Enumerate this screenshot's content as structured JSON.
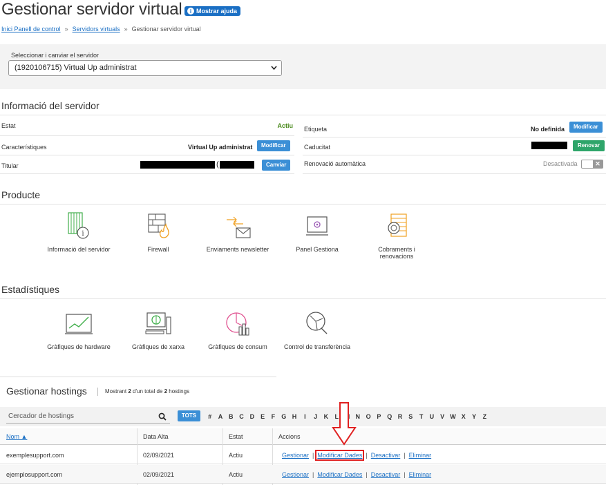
{
  "page": {
    "title": "Gestionar servidor virtual",
    "help_label": "Mostrar ajuda",
    "breadcrumb": [
      "Inici Panell de control",
      "Servidors virtuals",
      "Gestionar servidor virtual"
    ]
  },
  "server_selector": {
    "label": "Seleccionar i canviar el servidor",
    "selected": "(1920106715) Virtual Up administrat"
  },
  "server_info": {
    "heading": "Informació del servidor",
    "estat_label": "Estat",
    "estat_value": "Actiu",
    "caracteristiques_label": "Característiques",
    "caracteristiques_value": "Virtual Up administrat",
    "modify_label": "Modificar",
    "titular_label": "Titular",
    "titular_paren": "(",
    "canviar_label": "Canviar",
    "etiqueta_label": "Etiqueta",
    "etiqueta_value": "No definida",
    "modify_label_2": "Modificar",
    "caducitat_label": "Caducitat",
    "renovar_label": "Renovar",
    "renovacio_label": "Renovació automàtica",
    "renovacio_value": "Desactivada",
    "status_color": "#4a8a1c"
  },
  "producte": {
    "heading": "Producte",
    "tiles": [
      {
        "label": "Informació del servidor",
        "icon": "server-info-icon"
      },
      {
        "label": "Firewall",
        "icon": "firewall-icon"
      },
      {
        "label": "Enviaments newsletter",
        "icon": "newsletter-icon"
      },
      {
        "label": "Panel Gestiona",
        "icon": "panel-icon"
      },
      {
        "label": "Cobraments i renovacions",
        "icon": "billing-icon"
      }
    ]
  },
  "estadistiques": {
    "heading": "Estadístiques",
    "tiles": [
      {
        "label": "Gràfiques de hardware",
        "icon": "hardware-chart-icon"
      },
      {
        "label": "Gràfiques de xarxa",
        "icon": "network-chart-icon"
      },
      {
        "label": "Gràfiques de consum",
        "icon": "consumption-chart-icon"
      },
      {
        "label": "Control de transferència",
        "icon": "transfer-control-icon"
      }
    ]
  },
  "hostings": {
    "heading": "Gestionar hostings",
    "count_prefix": "Mostrant ",
    "count_shown": "2",
    "count_mid": " d'un total de ",
    "count_total": "2",
    "count_suffix": " hostings",
    "search_placeholder": "Cercador de hostings",
    "all_label": "TOTS",
    "letters": [
      "#",
      "A",
      "B",
      "C",
      "D",
      "E",
      "F",
      "G",
      "H",
      "I",
      "J",
      "K",
      "L",
      "M",
      "N",
      "O",
      "P",
      "Q",
      "R",
      "S",
      "T",
      "U",
      "V",
      "W",
      "X",
      "Y",
      "Z"
    ],
    "columns": [
      "Nom ▲",
      "Data Alta",
      "Estat",
      "Accions"
    ],
    "rows": [
      {
        "nom": "exemplesupport.com",
        "data": "02/09/2021",
        "estat": "Actiu"
      },
      {
        "nom": "ejemplosupport.com",
        "data": "02/09/2021",
        "estat": "Actiu"
      }
    ],
    "actions": [
      "Gestionar",
      "Modificar Dades",
      "Desactivar",
      "Eliminar"
    ],
    "accent": "#1a6fc4",
    "highlight_color": "#e02020"
  }
}
